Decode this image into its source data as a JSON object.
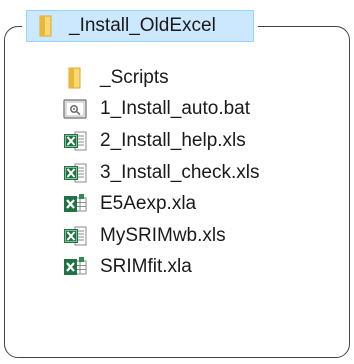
{
  "root": {
    "label": "_Install_OldExcel",
    "icon": "folder-icon"
  },
  "items": [
    {
      "label": "_Scripts",
      "icon": "folder-icon"
    },
    {
      "label": "1_Install_auto.bat",
      "icon": "batch-file-icon"
    },
    {
      "label": "2_Install_help.xls",
      "icon": "excel-workbook-icon"
    },
    {
      "label": "3_Install_check.xls",
      "icon": "excel-workbook-icon"
    },
    {
      "label": "E5Aexp.xla",
      "icon": "excel-addin-icon"
    },
    {
      "label": "MySRIMwb.xls",
      "icon": "excel-workbook-icon"
    },
    {
      "label": "SRIMfit.xla",
      "icon": "excel-addin-icon"
    }
  ],
  "colors": {
    "selection_bg": "#cce8ff",
    "selection_border": "#99d1ff",
    "folder": "#f4c542",
    "excel_green": "#1f7244",
    "frame": "#444444"
  }
}
